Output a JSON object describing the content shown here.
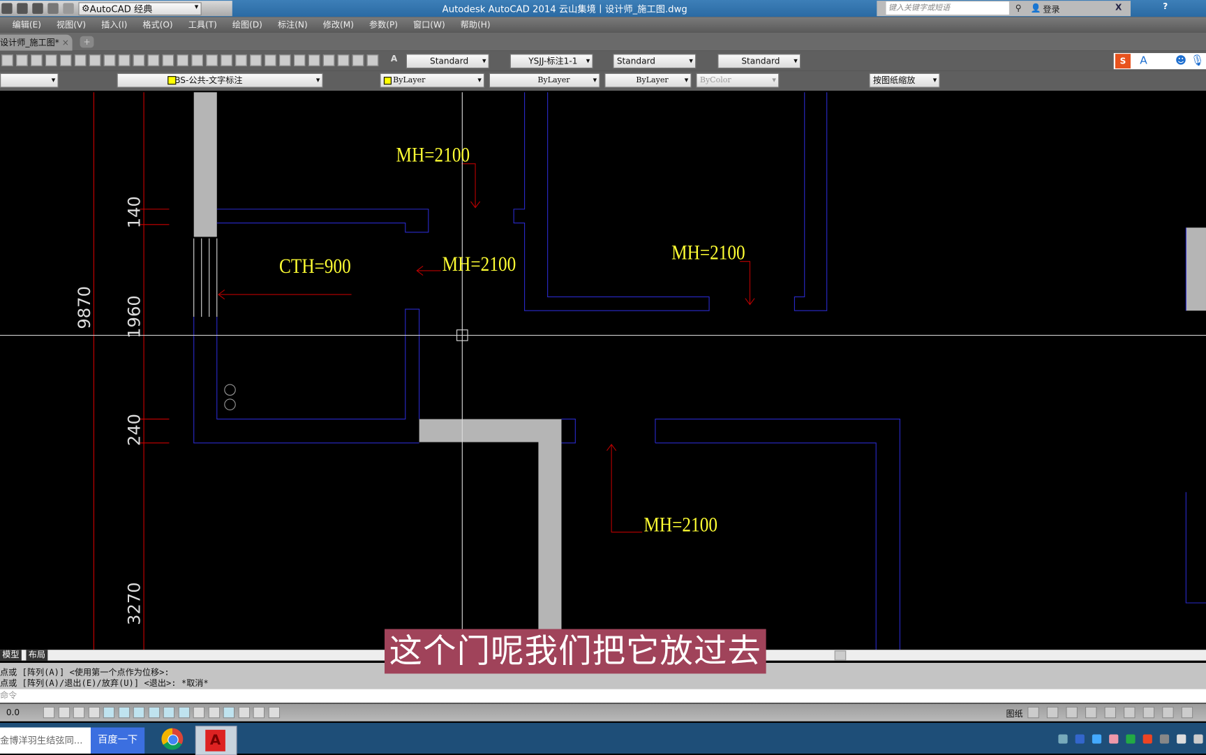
{
  "titlebar": {
    "workspace": "AutoCAD 经典",
    "title": "Autodesk AutoCAD 2014    云山集境丨设计师_施工图.dwg",
    "search_placeholder": "键入关键字或短语",
    "login": "登录"
  },
  "menu": [
    "编辑(E)",
    "视图(V)",
    "插入(I)",
    "格式(O)",
    "工具(T)",
    "绘图(D)",
    "标注(N)",
    "修改(M)",
    "参数(P)",
    "窗口(W)",
    "帮助(H)"
  ],
  "doc_tab": "设计师_施工图*",
  "toolbar": {
    "text_style": "Standard",
    "dim_style": "YSJJ-标注1-1",
    "table_style": "Standard",
    "mleader_style": "Standard",
    "layer": "BS-公共-文字标注",
    "color": "ByLayer",
    "linetype": "ByLayer",
    "lineweight": "ByLayer",
    "plotstyle": "ByColor",
    "scale": "按图纸缩放"
  },
  "drawing": {
    "labels": [
      "MH=2100",
      "MH=2100",
      "MH=2100",
      "CTH=900",
      "MH=2100"
    ],
    "dims": [
      "140",
      "9870",
      "1960",
      "240",
      "3270"
    ]
  },
  "layout_tabs": [
    "模型",
    "布局"
  ],
  "command": {
    "lines": [
      "点或 [阵列(A)] <使用第一个点作为位移>:",
      "点或 [阵列(A)/退出(E)/放弃(U)] <退出>: *取消*"
    ],
    "prompt": "命令"
  },
  "status": {
    "coords": "0.0",
    "paper": "图纸"
  },
  "taskbar": {
    "search_text": "金博洋羽生结弦同...",
    "search_btn": "百度一下"
  },
  "subtitle": "这个门呢我们把它放过去"
}
